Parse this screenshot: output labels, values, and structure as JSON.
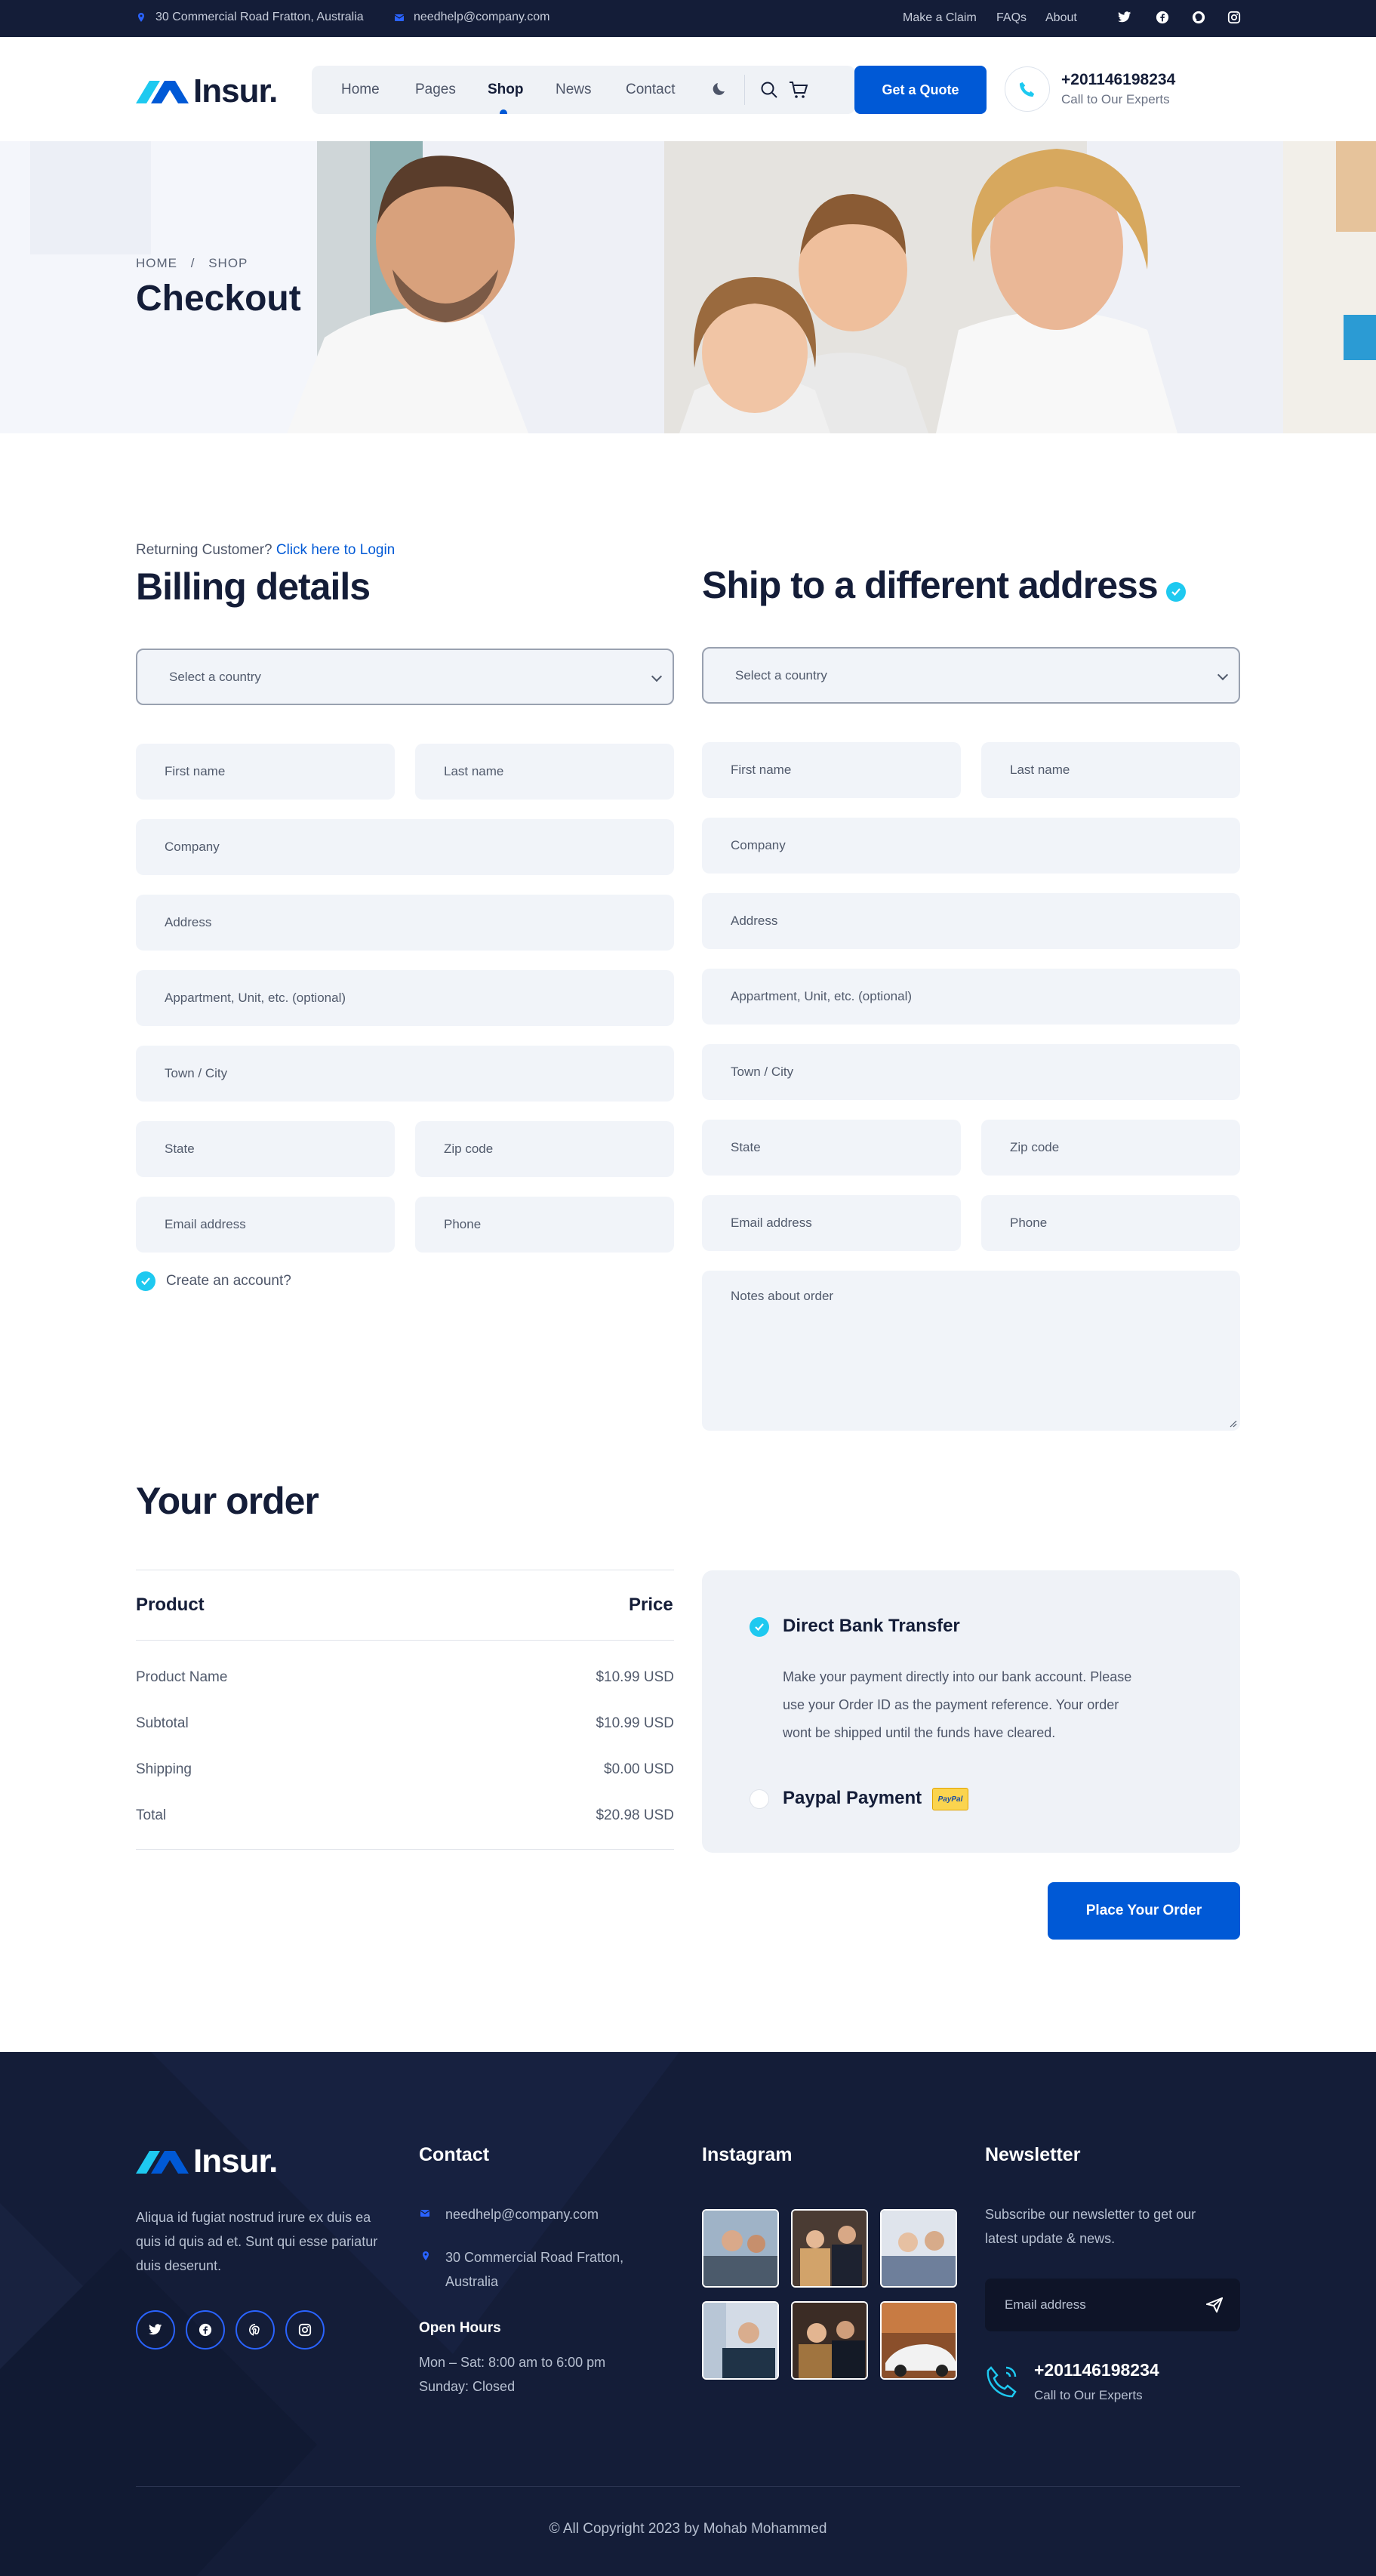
{
  "topbar": {
    "address": "30 Commercial Road Fratton, Australia",
    "email": "needhelp@company.com",
    "links": [
      "Make a Claim",
      "FAQs",
      "About"
    ],
    "social_icons": [
      "twitter-icon",
      "facebook-icon",
      "pinterest-icon",
      "instagram-icon"
    ]
  },
  "brand": {
    "name": "Insur."
  },
  "nav": {
    "items": [
      "Home",
      "Pages",
      "Shop",
      "News",
      "Contact"
    ],
    "active": "Shop",
    "quote_button": "Get a Quote",
    "phone": "+201146198234",
    "phone_caption": "Call to Our Experts"
  },
  "hero": {
    "breadcrumb_home": "HOME",
    "breadcrumb_sep": "/",
    "breadcrumb_current": "SHOP",
    "title": "Checkout"
  },
  "billing": {
    "returning_text": "Returning Customer?",
    "login_link": "Click here to Login",
    "title": "Billing details",
    "country_placeholder": "Select a country",
    "fields": {
      "first_name": "First name",
      "last_name": "Last name",
      "company": "Company",
      "address": "Address",
      "apartment": "Appartment, Unit, etc. (optional)",
      "town": "Town / City",
      "state": "State",
      "zip": "Zip code",
      "email": "Email address",
      "phone": "Phone"
    },
    "create_account": "Create an account?"
  },
  "shipping": {
    "title": "Ship to a different address",
    "country_placeholder": "Select a country",
    "fields": {
      "first_name": "First name",
      "last_name": "Last name",
      "company": "Company",
      "address": "Address",
      "apartment": "Appartment, Unit, etc. (optional)",
      "town": "Town / City",
      "state": "State",
      "zip": "Zip code",
      "email": "Email address",
      "phone": "Phone",
      "notes": "Notes about order"
    }
  },
  "order": {
    "title": "Your order",
    "col_product": "Product",
    "col_price": "Price",
    "rows": [
      {
        "label": "Product Name",
        "value": "$10.99 USD"
      },
      {
        "label": "Subtotal",
        "value": "$10.99 USD"
      },
      {
        "label": "Shipping",
        "value": "$0.00 USD"
      },
      {
        "label": "Total",
        "value": "$20.98 USD"
      }
    ]
  },
  "payment": {
    "bank_title": "Direct Bank Transfer",
    "bank_desc_1": "Make your payment directly into our bank account. Please",
    "bank_desc_2": "use your Order ID as the payment reference. Your order",
    "bank_desc_3": "wont be shipped until the funds have cleared.",
    "paypal_title": "Paypal Payment",
    "paypal_badge": "PayPal",
    "place_order": "Place Your Order"
  },
  "footer": {
    "about_1": "Aliqua id fugiat nostrud irure ex duis ea",
    "about_2": "quis id quis ad et. Sunt qui esse pariatur",
    "about_3": "duis deserunt.",
    "contact_title": "Contact",
    "contact_email": "needhelp@company.com",
    "contact_address_1": "30 Commercial Road Fratton,",
    "contact_address_2": "Australia",
    "hours_title": "Open Hours",
    "hours_1": "Mon – Sat: 8:00 am to 6:00 pm",
    "hours_2": "Sunday: Closed",
    "instagram_title": "Instagram",
    "newsletter_title": "Newsletter",
    "newsletter_1": "Subscribe our newsletter to get our",
    "newsletter_2": "latest update & news.",
    "newsletter_placeholder": "Email address",
    "phone": "+201146198234",
    "phone_caption": "Call to Our Experts",
    "copyright": "© All Copyright 2023 by Mohab Mohammed"
  },
  "colors": {
    "primary": "#0059d6",
    "dark": "#141d38",
    "accent": "#1ec9f0",
    "field": "#f1f4f9"
  }
}
